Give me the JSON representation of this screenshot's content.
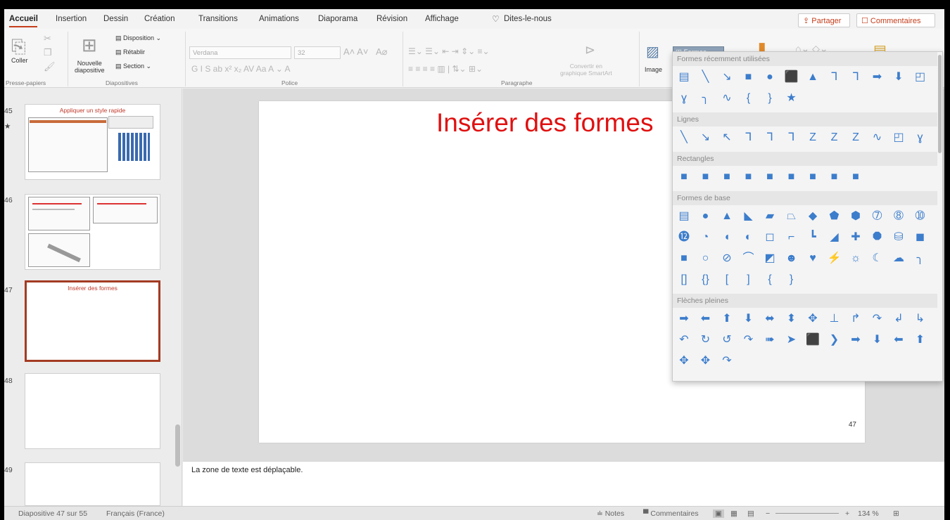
{
  "tabs": [
    "Accueil",
    "Insertion",
    "Dessin",
    "Création",
    "Transitions",
    "Animations",
    "Diaporama",
    "Révision",
    "Affichage",
    "Dites-le-nous"
  ],
  "top_buttons": {
    "share": "⇪ Partager",
    "comments": "☐ Commentaires"
  },
  "ribbon": {
    "paste_label": "Coller",
    "new_slide_label": "Nouvelle\ndiapositive",
    "layout_label": "Disposition ⌄",
    "reset_label": "Rétablir",
    "section_label": "Section ⌄",
    "font_name": "Verdana",
    "font_size": "32",
    "smartart_label": "Convertir en\ngraphique SmartArt",
    "image_label": "Image",
    "shapes_label": "Formes",
    "groups": {
      "clipboard": "Presse-papiers",
      "slides": "Diapositives",
      "font": "Police",
      "paragraph": "Paragraphe"
    }
  },
  "slides_panel": [
    {
      "number": "45",
      "title": "Appliquer un style rapide",
      "star": "★"
    },
    {
      "number": "46",
      "title": ""
    },
    {
      "number": "47",
      "title": "Insérer des formes",
      "selected": true
    },
    {
      "number": "48",
      "title": ""
    },
    {
      "number": "49",
      "title": ""
    }
  ],
  "slide": {
    "title": "Insérer des formes",
    "number": "47"
  },
  "notes": "La zone de texte est déplaçable.",
  "status": {
    "slide_info": "Diapositive 47 sur 55",
    "language": "Français (France)",
    "notes": "≐ Notes",
    "comments": "▀ Commentaires",
    "zoom": "134 %"
  },
  "gallery": {
    "sections": [
      {
        "title": "Formes récemment utilisées",
        "rows": [
          [
            "▤",
            "╲",
            "↘",
            "■",
            "●",
            "⬛",
            "▲",
            "ᒣ",
            "ᒣ",
            "➡",
            "⬇",
            "◰"
          ],
          [
            "ɣ",
            "╮",
            "∿",
            "{",
            "}",
            "★"
          ]
        ]
      },
      {
        "title": "Lignes",
        "rows": [
          [
            "╲",
            "↘",
            "↖",
            "ᒣ",
            "ᒣ",
            "ᒣ",
            "Z",
            "Z",
            "Z",
            "∿",
            "◰",
            "ɣ"
          ]
        ]
      },
      {
        "title": "Rectangles",
        "rows": [
          [
            "■",
            "■",
            "■",
            "■",
            "■",
            "■",
            "■",
            "■",
            "■"
          ]
        ]
      },
      {
        "title": "Formes de base",
        "rows": [
          [
            "▤",
            "●",
            "▲",
            "◣",
            "▰",
            "⏢",
            "◆",
            "⬟",
            "⬢",
            "➆",
            "➇",
            "➉"
          ],
          [
            "⓬",
            "◔",
            "◖",
            "◐",
            "◻",
            "⌐",
            "┗",
            "◢",
            "✚",
            "⯃",
            "⛁",
            "◼"
          ],
          [
            "■",
            "○",
            "⊘",
            "⌒",
            "◩",
            "☻",
            "♥",
            "⚡",
            "☼",
            "☾",
            "☁",
            "╮"
          ],
          [
            "[]",
            "{}",
            "[",
            "]",
            "{",
            "}"
          ]
        ]
      },
      {
        "title": "Flèches pleines",
        "rows": [
          [
            "➡",
            "⬅",
            "⬆",
            "⬇",
            "⬌",
            "⬍",
            "✥",
            "⊥",
            "↱",
            "↷",
            "↲",
            "↳"
          ],
          [
            "↶",
            "↻",
            "↺",
            "↷",
            "➠",
            "➤",
            "⬛",
            "❯",
            "➡",
            "⬇",
            "⬅",
            "⬆"
          ],
          [
            "✥",
            "✥",
            "↷"
          ]
        ]
      }
    ]
  }
}
